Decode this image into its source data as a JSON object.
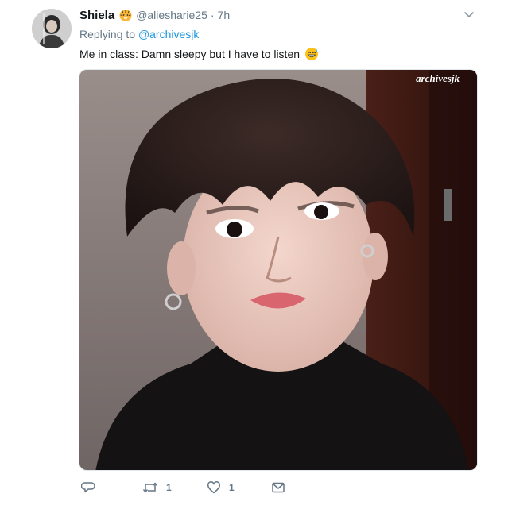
{
  "tweet": {
    "author_name": "Shiela",
    "author_handle": "@aliesharie25",
    "separator": "·",
    "time": "7h",
    "replying_label": "Replying to",
    "replying_to": "@archivesjk",
    "text": "Me in class: Damn sleepy but I have to listen",
    "media": {
      "watermark": "archivesjk"
    },
    "actions": {
      "reply_count": "",
      "retweet_count": "1",
      "like_count": "1"
    }
  },
  "icons": {
    "name_badge": "tiger-face-icon",
    "text_emoji": "grinning-sweat-icon",
    "caret": "chevron-down-icon",
    "reply": "reply-icon",
    "retweet": "retweet-icon",
    "like": "heart-icon",
    "dm": "envelope-icon"
  },
  "colors": {
    "primary_text": "#14171a",
    "secondary_text": "#657786",
    "link": "#1b95e0"
  }
}
